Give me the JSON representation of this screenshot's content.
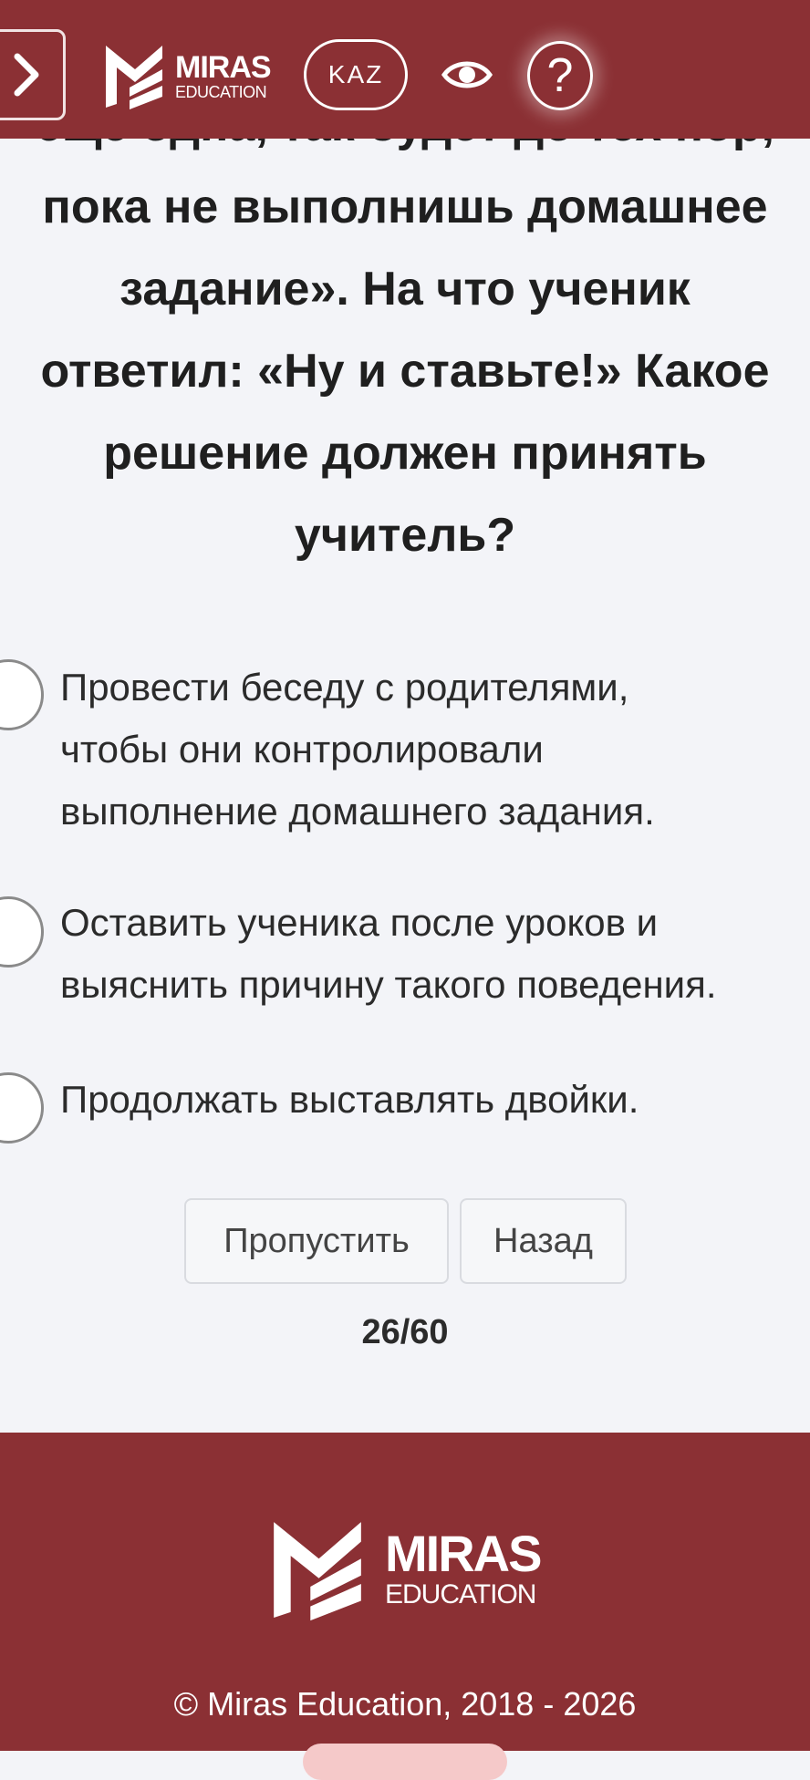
{
  "header": {
    "logo_line1": "MIRAS",
    "logo_line2": "EDUCATION",
    "language": "KAZ",
    "help": "?"
  },
  "question": {
    "lines": [
      "еще одна, так будет до тех пор,",
      "пока не выполнишь домашнее",
      "задание». На что ученик",
      "ответил: «Ну и ставьте!» Какое",
      "решение должен принять",
      "учитель?"
    ]
  },
  "answers": [
    {
      "lines": [
        "Провести беседу с родителями,",
        "чтобы они контролировали",
        "выполнение домашнего задания."
      ]
    },
    {
      "lines": [
        "Оставить ученика после уроков и",
        "выяснить причину такого поведения."
      ]
    },
    {
      "lines": [
        "Продолжать выставлять двойки."
      ]
    }
  ],
  "buttons": {
    "skip": "Пропустить",
    "back": "Назад"
  },
  "progress": "26/60",
  "footer": {
    "logo_line1": "MIRAS",
    "logo_line2": "EDUCATION",
    "copyright": "© Miras Education, 2018 - 2026"
  },
  "colors": {
    "brand": "#8b3034",
    "background": "#f3f4f8"
  }
}
